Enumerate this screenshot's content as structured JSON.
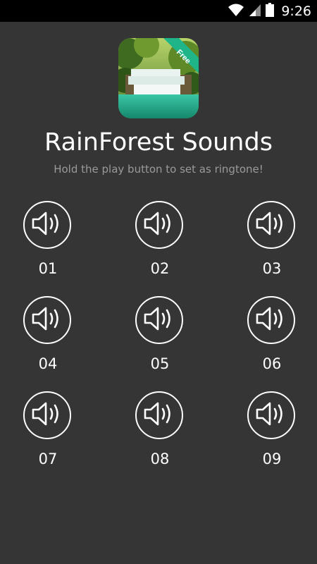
{
  "status_bar": {
    "time": "9:26",
    "icons": [
      "wifi-icon",
      "signal-icon",
      "battery-icon"
    ]
  },
  "app": {
    "title": "RainForest Sounds",
    "subtitle": "Hold the play button to set as ringtone!",
    "badge": "Free",
    "badge_color": "#1fb589",
    "background": "#353535"
  },
  "sounds": [
    {
      "label": "01",
      "icon": "speaker-icon"
    },
    {
      "label": "02",
      "icon": "speaker-icon"
    },
    {
      "label": "03",
      "icon": "speaker-icon"
    },
    {
      "label": "04",
      "icon": "speaker-icon"
    },
    {
      "label": "05",
      "icon": "speaker-icon"
    },
    {
      "label": "06",
      "icon": "speaker-icon"
    },
    {
      "label": "07",
      "icon": "speaker-icon"
    },
    {
      "label": "08",
      "icon": "speaker-icon"
    },
    {
      "label": "09",
      "icon": "speaker-icon"
    }
  ]
}
